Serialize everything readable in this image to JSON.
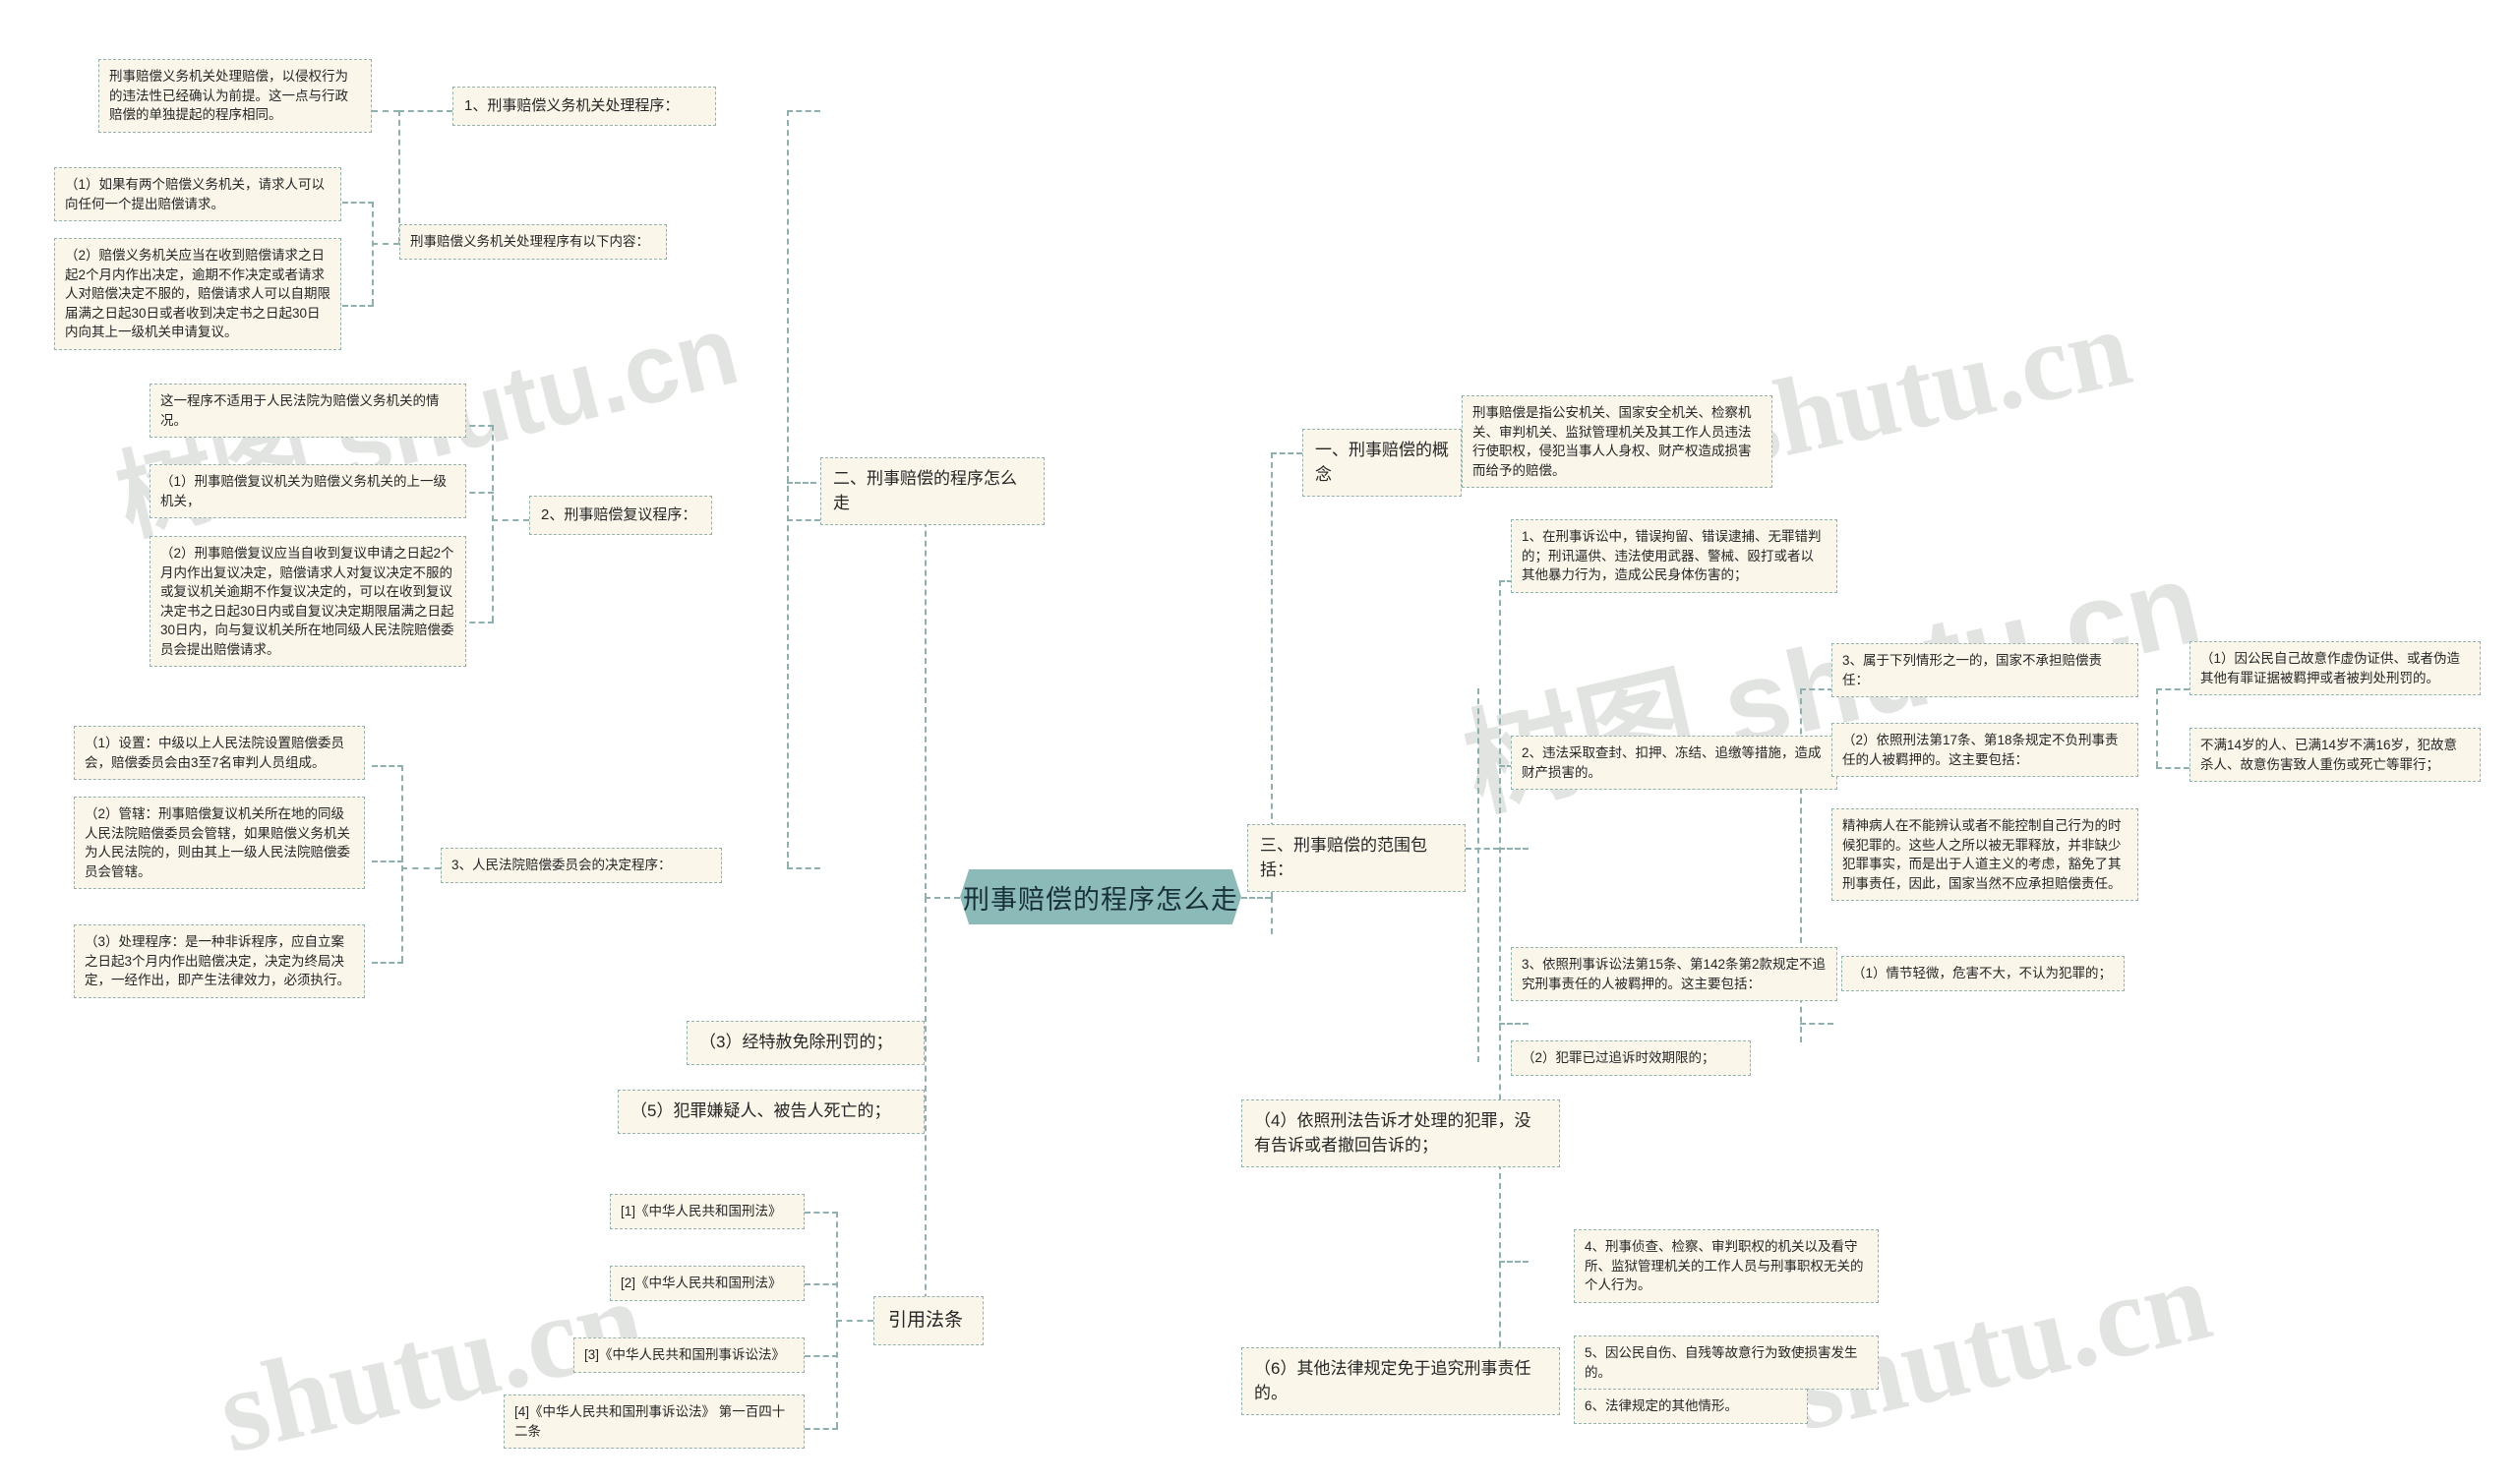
{
  "title": "刑事赔偿的程序怎么走",
  "root": {
    "label": "刑事赔偿的程序怎么走"
  },
  "watermarks": [
    {
      "text": "树图 shutu.cn"
    },
    {
      "text": "shutu.cn"
    },
    {
      "text": "树图 shutu.cn"
    },
    {
      "text": "shutu.cn"
    },
    {
      "text": "shutu.cn"
    }
  ],
  "branches": {
    "concept": {
      "label": "一、刑事赔偿的概念",
      "detail": "刑事赔偿是指公安机关、国家安全机关、检察机关、审判机关、监狱管理机关及其工作人员违法行使职权，侵犯当事人人身权、财产权造成损害而给予的赔偿。"
    },
    "procedure": {
      "label": "二、刑事赔偿的程序怎么走",
      "sub1": {
        "label": "1、刑事赔偿义务机关处理程序：",
        "note": "刑事赔偿义务机关处理赔偿，以侵权行为的违法性已经确认为前提。这一点与行政赔偿的单独提起的程序相同。",
        "contents_label": "刑事赔偿义务机关处理程序有以下内容：",
        "items": [
          "（1）如果有两个赔偿义务机关，请求人可以向任何一个提出赔偿请求。",
          "（2）赔偿义务机关应当在收到赔偿请求之日起2个月内作出决定，逾期不作决定或者请求人对赔偿决定不服的，赔偿请求人可以自期限届满之日起30日或者收到决定书之日起30日内向其上一级机关申请复议。"
        ]
      },
      "sub2": {
        "label": "2、刑事赔偿复议程序：",
        "note": "这一程序不适用于人民法院为赔偿义务机关的情况。",
        "items": [
          "（1）刑事赔偿复议机关为赔偿义务机关的上一级机关，",
          "（2）刑事赔偿复议应当自收到复议申请之日起2个月内作出复议决定，赔偿请求人对复议决定不服的或复议机关逾期不作复议决定的，可以在收到复议决定书之日起30日内或自复议决定期限届满之日起30日内，向与复议机关所在地同级人民法院赔偿委员会提出赔偿请求。"
        ]
      },
      "sub3": {
        "label": "3、人民法院赔偿委员会的决定程序：",
        "items": [
          "（1）设置：中级以上人民法院设置赔偿委员会，赔偿委员会由3至7名审判人员组成。",
          "（2）管辖：刑事赔偿复议机关所在地的同级人民法院赔偿委员会管辖，如果赔偿义务机关为人民法院的，则由其上一级人民法院赔偿委员会管辖。",
          "（3）处理程序：是一种非诉程序，应自立案之日起3个月内作出赔偿决定，决定为终局决定，一经作出，即产生法律效力，必须执行。"
        ]
      }
    },
    "scope": {
      "label": "三、刑事赔偿的范围包括：",
      "item1": "1、在刑事诉讼中，错误拘留、错误逮捕、无罪错判的；刑讯逼供、违法使用武器、警械、殴打或者以其他暴力行为，造成公民身体伤害的；",
      "item2": "2、违法采取查封、扣押、冻结、追缴等措施，造成财产损害的。",
      "item3": {
        "label": "3、属于下列情形之一的，国家不承担赔偿责任：",
        "sub1": "（1）因公民自己故意作虚伪证供、或者伪造其他有罪证据被羁押或者被判处刑罚的。",
        "sub2_label": "（2）依照刑法第17条、第18条规定不负刑事责任的人被羁押的。这主要包括：",
        "sub2_detail_a": "不满14岁的人、已满14岁不满16岁，犯故意杀人、故意伤害致人重伤或死亡等罪行；",
        "sub2_detail_b": "精神病人在不能辨认或者不能控制自己行为的时候犯罪的。这些人之所以被无罪释放，并非缺少犯罪事实，而是出于人道主义的考虑，豁免了其刑事责任，因此，国家当然不应承担赔偿责任。",
        "sub3_label": "3、依照刑事诉讼法第15条、第142条第2款规定不追究刑事责任的人被羁押的。这主要包括：",
        "sub3_items": [
          "（1）情节轻微，危害不大，不认为犯罪的；",
          "（2）犯罪已过追诉时效期限的；",
          "（3）经特赦免除刑罚的；",
          "（4）依照刑法告诉才处理的犯罪，没有告诉或者撤回告诉的；",
          "（5）犯罪嫌疑人、被告人死亡的；",
          "（6）其他法律规定免于追究刑事责任的。"
        ]
      },
      "item4": "4、刑事侦查、检察、审判职权的机关以及看守所、监狱管理机关的工作人员与刑事职权无关的个人行为。",
      "item5": "5、因公民自伤、自残等故意行为致使损害发生的。",
      "item6": "6、法律规定的其他情形。"
    },
    "citations": {
      "label": "引用法条",
      "items": [
        "[1]《中华人民共和国刑法》",
        "[2]《中华人民共和国刑法》",
        "[3]《中华人民共和国刑事诉讼法》",
        "[4]《中华人民共和国刑事诉讼法》 第一百四十二条"
      ]
    }
  },
  "colors": {
    "root_fill": "#8cbab8",
    "node_fill": "#faf6ea",
    "node_border": "#93b2b0",
    "line": "#8fb0ae",
    "text": "#262626",
    "watermark": "#d9dcd9"
  }
}
